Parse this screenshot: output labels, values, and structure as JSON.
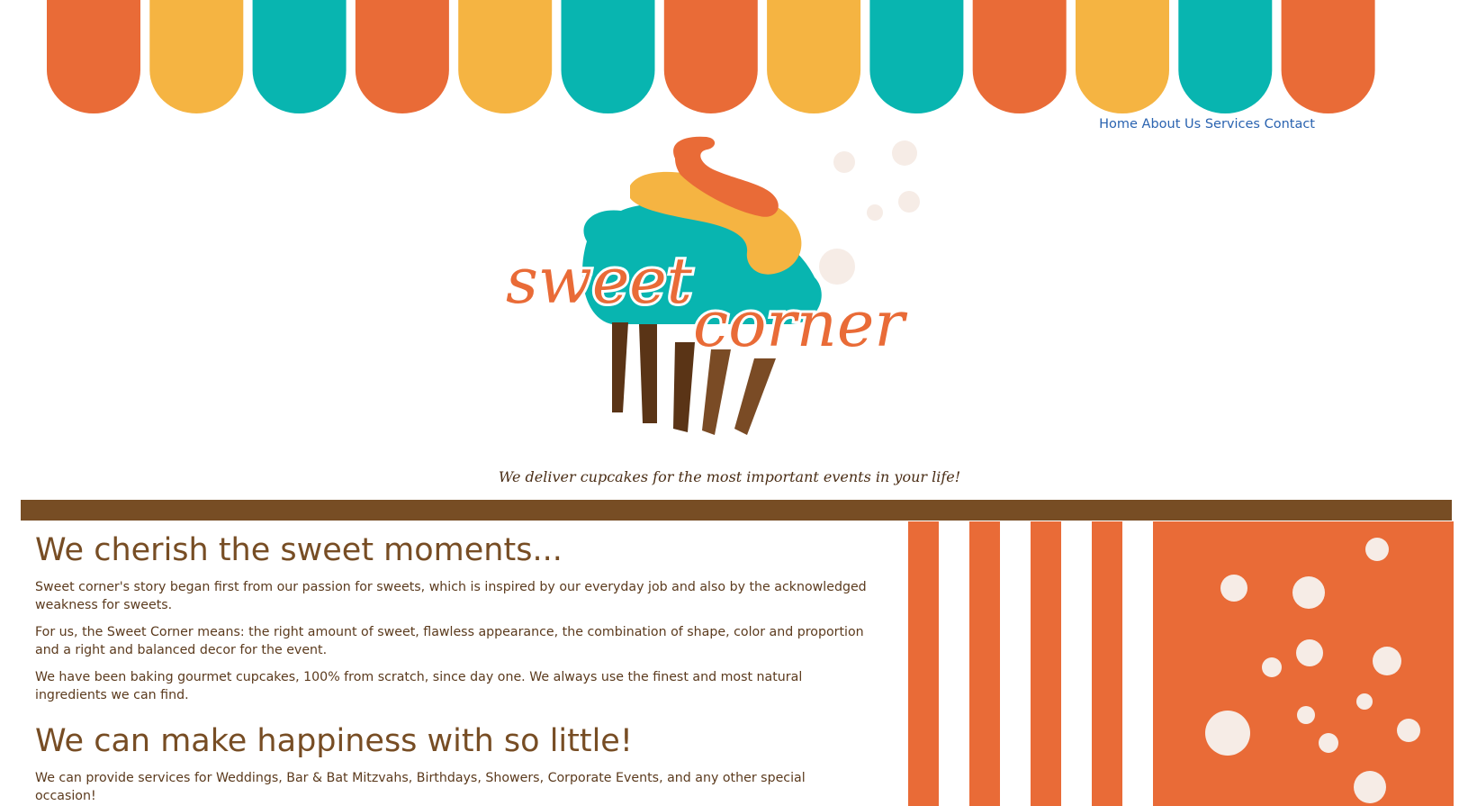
{
  "nav": {
    "items": [
      "Home",
      "About Us",
      "Services",
      "Contact"
    ]
  },
  "logo": {
    "word1": "sweet",
    "word2": "corner"
  },
  "tagline": "We deliver cupcakes for the most important events in your life!",
  "content": {
    "heading1": "We cherish the sweet moments...",
    "paragraphs1": [
      "Sweet corner's story began first from our passion for sweets, which is inspired by our everyday job and also by the acknowledged weakness for sweets.",
      "For us, the Sweet Corner means: the right amount of sweet, flawless appearance, the combination of shape, color and proportion and a right and balanced decor for the event.",
      "We have been baking gourmet cupcakes, 100% from scratch, since day one. We always use the finest and most natural ingredients we can find."
    ],
    "heading2": "We can make happiness with so little!",
    "paragraphs2": [
      "We can provide services for Weddings, Bar & Bat Mitzvahs, Birthdays, Showers, Corporate Events, and any other special occasion!"
    ]
  },
  "colors": {
    "orange": "#e96b37",
    "yellow": "#f5b442",
    "teal": "#08b5b0",
    "brown": "#774d24",
    "dark_brown": "#5a3416",
    "link_blue": "#2a63b0",
    "bubble": "#f6ece6"
  }
}
